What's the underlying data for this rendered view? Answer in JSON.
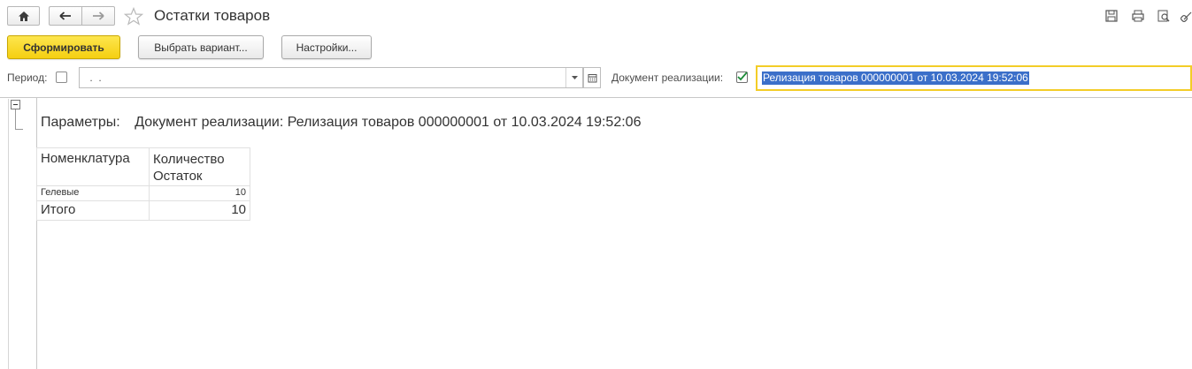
{
  "window": {
    "title": "Остатки товаров"
  },
  "nav": {
    "home_icon": "home-icon",
    "back_icon": "back-arrow-icon",
    "forward_icon": "forward-arrow-icon",
    "favorite_icon": "star-icon"
  },
  "toolbar": {
    "generate_label": "Сформировать",
    "variant_label": "Выбрать вариант...",
    "settings_label": "Настройки..."
  },
  "filters": {
    "period_label": "Период:",
    "period_value": " .  .",
    "doc_label": "Документ реализации:",
    "doc_value": "Релизация товаров 000000001 от 10.03.2024 19:52:06"
  },
  "report": {
    "params_label": "Параметры:",
    "params_value": "Документ реализации: Релизация товаров 000000001 от 10.03.2024 19:52:06",
    "columns": {
      "item": "Номенклатура",
      "qty_line1": "Количество",
      "qty_line2": "Остаток"
    },
    "rows": [
      {
        "item": "Гелевые",
        "qty": "10"
      }
    ],
    "total": {
      "label": "Итого",
      "qty": "10"
    }
  }
}
